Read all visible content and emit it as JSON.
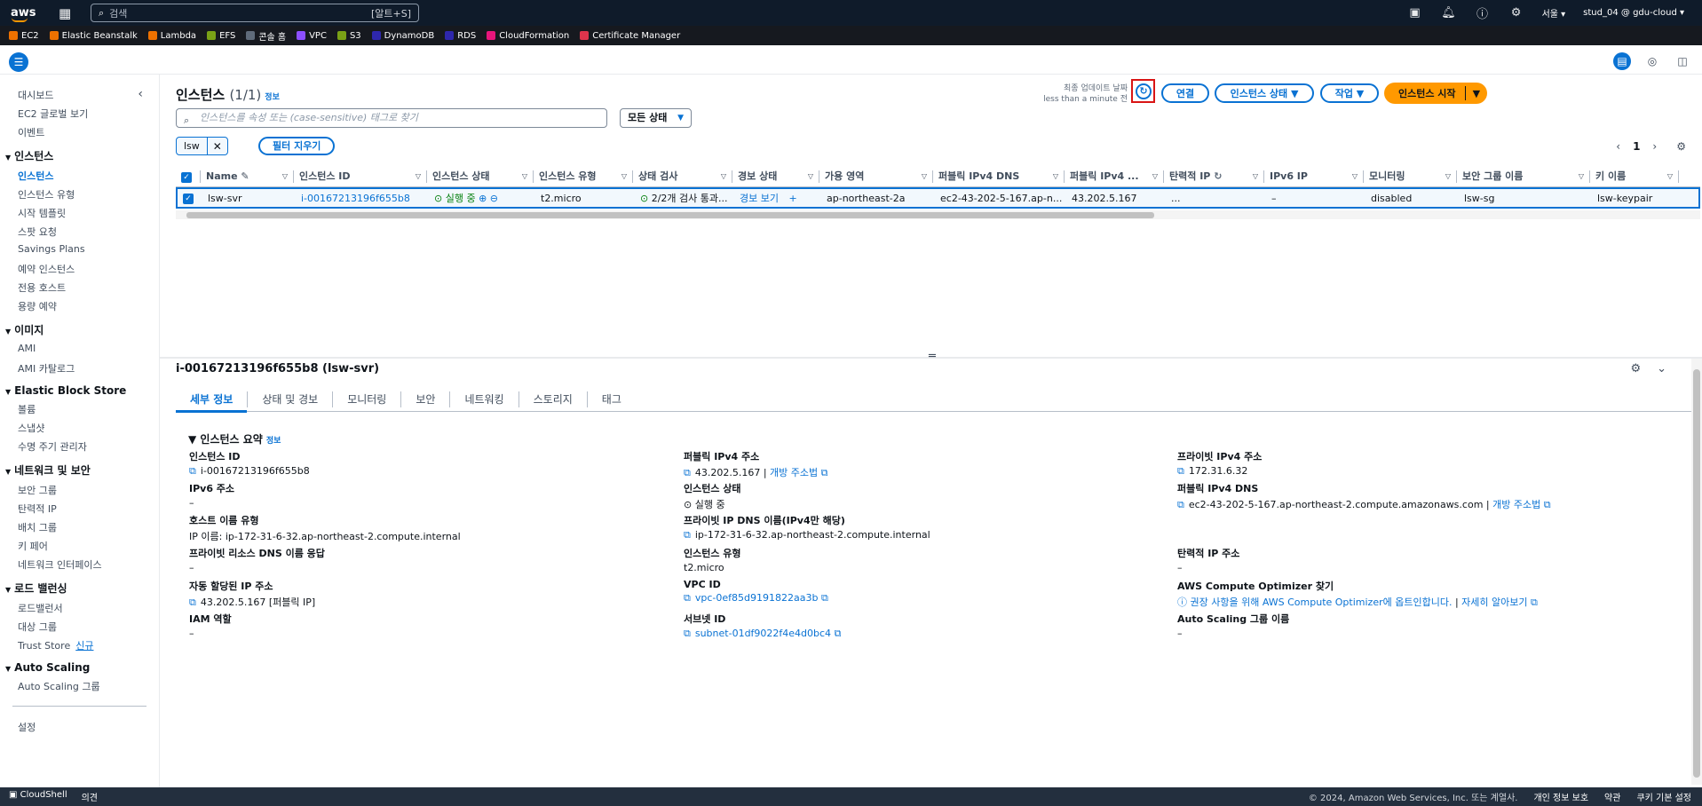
{
  "topnav": {
    "logo": "aws",
    "search_placeholder": "검색",
    "shortcut": "[알트+S]",
    "region": "서울 ▾",
    "account": "stud_04 @ gdu-cloud ▾"
  },
  "favorites": [
    {
      "label": "EC2",
      "color": "#ed7100"
    },
    {
      "label": "Elastic Beanstalk",
      "color": "#ed7100"
    },
    {
      "label": "Lambda",
      "color": "#ed7100"
    },
    {
      "label": "EFS",
      "color": "#7aa116"
    },
    {
      "label": "콘솔 홈",
      "color": "#5f6b7a"
    },
    {
      "label": "VPC",
      "color": "#8c4fff"
    },
    {
      "label": "S3",
      "color": "#7aa116"
    },
    {
      "label": "DynamoDB",
      "color": "#2e27ad"
    },
    {
      "label": "RDS",
      "color": "#2e27ad"
    },
    {
      "label": "CloudFormation",
      "color": "#e7157b"
    },
    {
      "label": "Certificate Manager",
      "color": "#dd344c"
    }
  ],
  "sidebar": {
    "top": [
      "대시보드",
      "EC2 글로벌 보기",
      "이벤트"
    ],
    "sections": [
      {
        "title": "인스턴스",
        "items": [
          "인스턴스",
          "인스턴스 유형",
          "시작 템플릿",
          "스팟 요청",
          "Savings Plans",
          "예약 인스턴스",
          "전용 호스트",
          "용량 예약"
        ]
      },
      {
        "title": "이미지",
        "items": [
          "AMI",
          "AMI 카탈로그"
        ]
      },
      {
        "title": "Elastic Block Store",
        "items": [
          "볼륨",
          "스냅샷",
          "수명 주기 관리자"
        ]
      },
      {
        "title": "네트워크 및 보안",
        "items": [
          "보안 그룹",
          "탄력적 IP",
          "배치 그룹",
          "키 페어",
          "네트워크 인터페이스"
        ]
      },
      {
        "title": "로드 밸런싱",
        "items": [
          "로드밸런서",
          "대상 그룹",
          "Trust Store"
        ]
      },
      {
        "title": "Auto Scaling",
        "items": [
          "Auto Scaling 그룹"
        ]
      }
    ],
    "new_badge": "신규",
    "settings": "설정"
  },
  "header": {
    "title": "인스턴스",
    "count": "(1/1)",
    "info": "정보",
    "last_update_label": "최종 업데이트 날짜",
    "last_update_value": "less than a minute 전",
    "connect": "연결",
    "state": "인스턴스 상태 ▼",
    "actions": "작업 ▼",
    "launch": "인스턴스 시작"
  },
  "filter": {
    "placeholder": "인스턴스를 속성 또는 (case-sensitive) 태그로 찾기",
    "status": "모든 상태",
    "token": "lsw",
    "clear": "필터 지우기",
    "page": "1"
  },
  "table": {
    "headers": [
      "Name",
      "인스턴스 ID",
      "인스턴스 상태",
      "인스턴스 유형",
      "상태 검사",
      "경보 상태",
      "가용 영역",
      "퍼블릭 IPv4 DNS",
      "퍼블릭 IPv4 ...",
      "탄력적 IP",
      "IPv6 IP",
      "모니터링",
      "보안 그룹 이름",
      "키 이름"
    ],
    "row": {
      "name": "lsw-svr",
      "id": "i-00167213196f655b8",
      "state": "실행 중",
      "type": "t2.micro",
      "check": "2/2개 검사 통과...",
      "alarm": "경보 보기",
      "az": "ap-northeast-2a",
      "dns": "ec2-43-202-5-167.ap-n...",
      "ipv4": "43.202.5.167",
      "eip": "...",
      "ipv6": "–",
      "monitor": "disabled",
      "sg": "lsw-sg",
      "key": "lsw-keypair"
    }
  },
  "detail": {
    "title": "i-00167213196f655b8 (lsw-svr)",
    "tabs": [
      "세부 정보",
      "상태 및 경보",
      "모니터링",
      "보안",
      "네트워킹",
      "스토리지",
      "태그"
    ],
    "summary": "인스턴스 요약",
    "info": "정보",
    "f": {
      "id_k": "인스턴스 ID",
      "id_v": "i-00167213196f655b8",
      "ipv6_k": "IPv6 주소",
      "ipv6_v": "–",
      "host_k": "호스트 이름 유형",
      "host_v": "IP 이름: ip-172-31-6-32.ap-northeast-2.compute.internal",
      "prdns_k": "프라이빗 리소스 DNS 이름 응답",
      "prdns_v": "–",
      "auto_k": "자동 할당된 IP 주소",
      "auto_v": "43.202.5.167 [퍼블릭 IP]",
      "iam_k": "IAM 역할",
      "iam_v": "–",
      "pub_k": "퍼블릭 IPv4 주소",
      "pub_v": "43.202.5.167",
      "open": "개방 주소법",
      "state_k": "인스턴스 상태",
      "state_v": "실행 중",
      "pdns_k": "프라이빗 IP DNS 이름(IPv4만 해당)",
      "pdns_v": "ip-172-31-6-32.ap-northeast-2.compute.internal",
      "type_k": "인스턴스 유형",
      "type_v": "t2.micro",
      "vpc_k": "VPC ID",
      "vpc_v": "vpc-0ef85d9191822aa3b",
      "sub_k": "서브넷 ID",
      "sub_v": "subnet-01df9022f4e4d0bc4",
      "priv_k": "프라이빗 IPv4 주소",
      "priv_v": "172.31.6.32",
      "pubdns_k": "퍼블릭 IPv4 DNS",
      "pubdns_v": "ec2-43-202-5-167.ap-northeast-2.compute.amazonaws.com",
      "eip_k": "탄력적 IP 주소",
      "eip_v": "–",
      "opt_k": "AWS Compute Optimizer 찾기",
      "opt_v": "권장 사항을 위해 AWS Compute Optimizer에 옵트인합니다.",
      "learn": "자세히 알아보기",
      "asg_k": "Auto Scaling 그룹 이름",
      "asg_v": "–"
    }
  },
  "footer": {
    "cloudshell": "CloudShell",
    "feedback": "의견",
    "copyright": "© 2024, Amazon Web Services, Inc. 또는 계열사.",
    "privacy": "개인 정보 보호",
    "terms": "약관",
    "cookies": "쿠키 기본 설정"
  }
}
